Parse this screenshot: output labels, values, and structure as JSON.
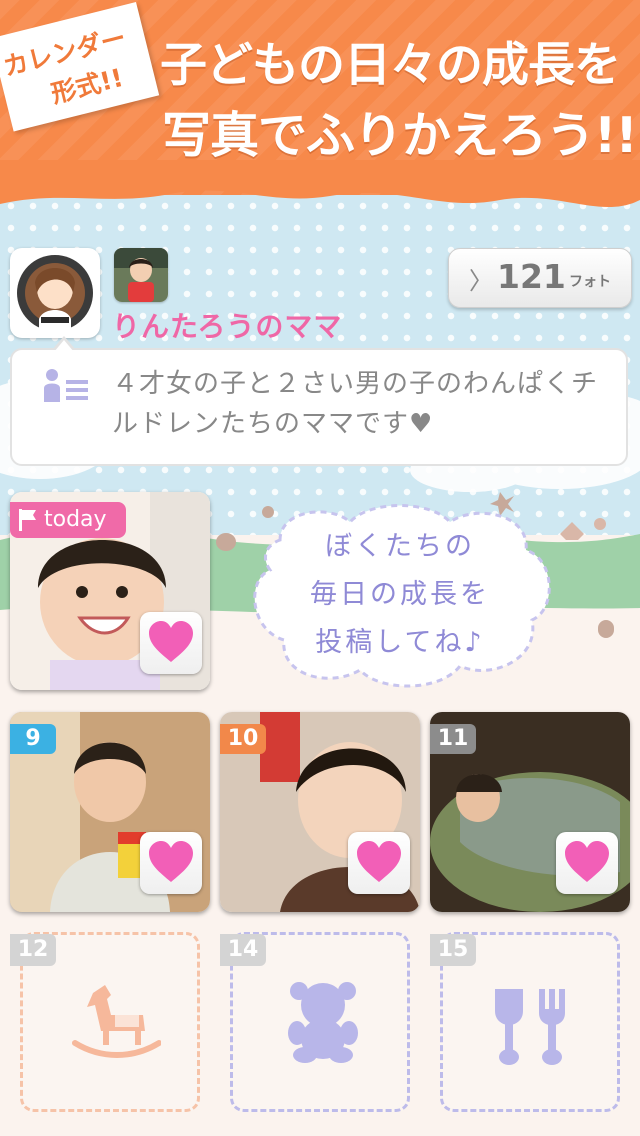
{
  "banner": {
    "badge_line1": "カレンダー",
    "badge_line2": "形式!!",
    "headline_line1": "子どもの日々の成長を",
    "headline_line2": "写真でふりかえろう!!"
  },
  "profile": {
    "avatar_icon": "user-avatar",
    "child_icon": "child-photo",
    "name": "りんたろうのママ",
    "photo_count": "121",
    "photo_unit": "フォト",
    "bio": "４才女の子と２さい男の子のわんぱくチルドレンたちのママです♥"
  },
  "today": {
    "label": "today",
    "prompt_lines": [
      "ぼくたちの",
      "毎日の成長を",
      "投稿してね♪"
    ]
  },
  "days": [
    {
      "num": "9",
      "color": "#3bb1e3",
      "icon": "heart-icon"
    },
    {
      "num": "10",
      "color": "#f2884a",
      "icon": "heart-icon"
    },
    {
      "num": "11",
      "color": "#8c8c8c",
      "icon": "heart-icon"
    }
  ],
  "empty_days": [
    {
      "num": "12",
      "icon": "rocking-horse-icon",
      "color": "#f6b89b"
    },
    {
      "num": "14",
      "icon": "teddy-bear-icon",
      "color": "#b8b6e9"
    },
    {
      "num": "15",
      "icon": "spoon-fork-icon",
      "color": "#b8b6e9"
    }
  ],
  "colors": {
    "accent": "#f7894a",
    "pink": "#ef67a6",
    "lavender": "#8f8ad6"
  }
}
